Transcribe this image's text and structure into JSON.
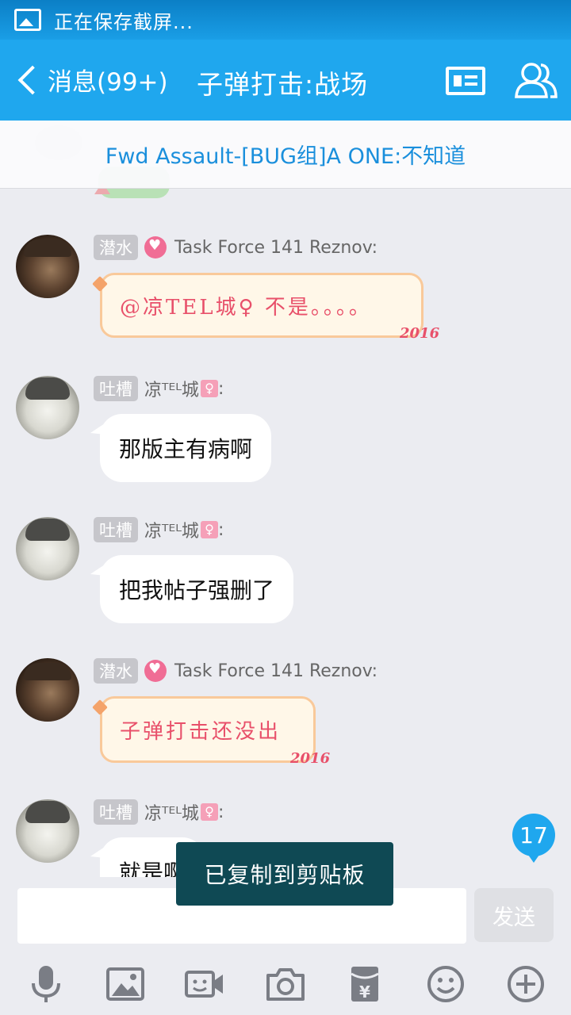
{
  "status_bar": {
    "text": "正在保存截屏..."
  },
  "nav": {
    "back_label": "消息(99+)",
    "title": "子弹打击:战场"
  },
  "pinned": {
    "text": "Fwd Assault-[BUG组]A ONE:不知道"
  },
  "messages": [
    {
      "tag": "潜水",
      "sender": "Task Force 141 Reznov:",
      "text": "@凉TEL城♀ 不是。。。。",
      "year": "2016"
    },
    {
      "tag": "吐槽",
      "sender": "凉ᵀᴱᴸ城",
      "suffix": ":",
      "text": "那版主有病啊"
    },
    {
      "tag": "吐槽",
      "sender": "凉ᵀᴱᴸ城",
      "suffix": ":",
      "text": "把我帖子强删了"
    },
    {
      "tag": "潜水",
      "sender": "Task Force 141 Reznov:",
      "text": "子弹打击还没出",
      "year": "2016"
    },
    {
      "tag": "吐槽",
      "sender": "凉ᵀᴱᴸ城",
      "suffix": ":",
      "text": "就是啊"
    }
  ],
  "unread_badge": "17",
  "toast": "已复制到剪贴板",
  "input": {
    "value": "",
    "send_label": "发送"
  },
  "toolbar": [
    "mic-icon",
    "image-icon",
    "video-call-icon",
    "camera-icon",
    "red-packet-icon",
    "emoji-icon",
    "plus-icon"
  ],
  "colors": {
    "accent": "#1fa7ee",
    "toast_bg": "#0f4954",
    "special_text": "#e8506a",
    "chat_bg": "#ebecf1"
  }
}
